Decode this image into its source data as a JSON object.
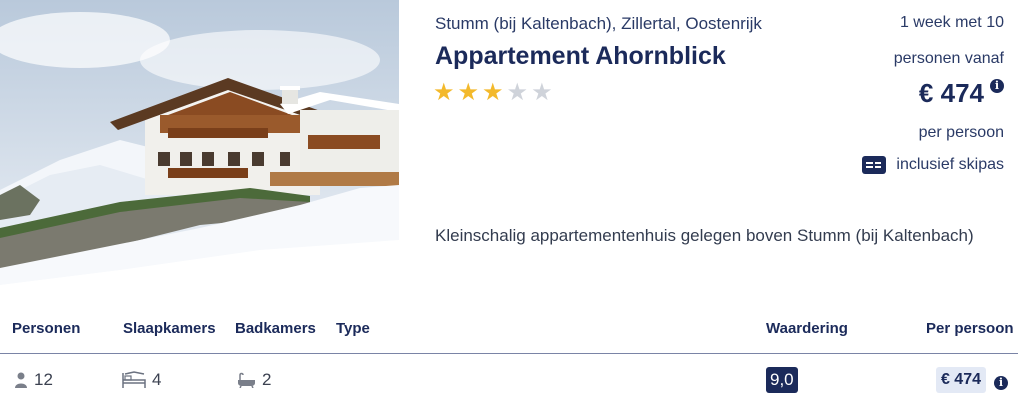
{
  "listing": {
    "location": "Stumm (bij Kaltenbach), Zillertal, Oostenrijk",
    "title": "Appartement Ahornblick",
    "stars": {
      "rating": 3,
      "max": 5
    },
    "description": "Kleinschalig appartementenhuis gelegen boven Stumm (bij Kaltenbach)"
  },
  "price_block": {
    "line1": "1 week met 10",
    "line2": "personen vanaf",
    "price": "€ 474",
    "per": "per persoon",
    "skipass": "inclusief skipas"
  },
  "table": {
    "headers": {
      "personen": "Personen",
      "slaapkamers": "Slaapkamers",
      "badkamers": "Badkamers",
      "type": "Type",
      "waardering": "Waardering",
      "per_persoon": "Per persoon"
    },
    "row": {
      "personen": "12",
      "slaapkamers": "4",
      "badkamers": "2",
      "waardering": "9,0",
      "price": "€ 474"
    }
  },
  "icons": {
    "star_on_color": "#f3b92b",
    "star_off_color": "#cfd3da",
    "brand_navy": "#1b2a5a",
    "person": "person-icon",
    "bed": "bed-icon",
    "bath": "bath-icon",
    "info": "info-icon",
    "skipass": "skipass-card-icon"
  }
}
